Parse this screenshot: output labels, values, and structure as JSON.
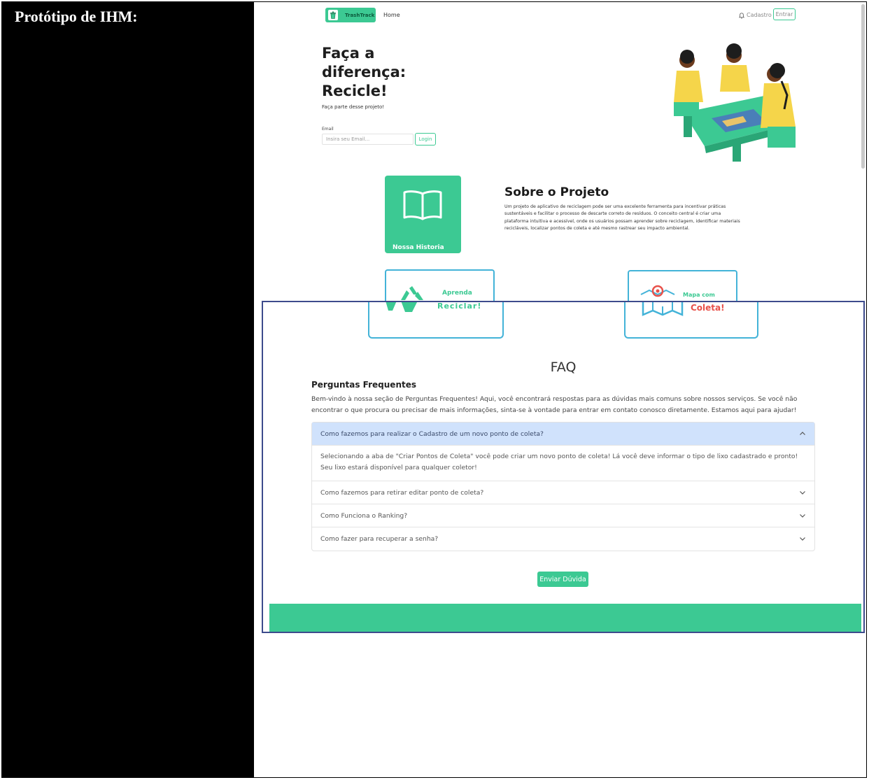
{
  "doc": {
    "label": "Protótipo de IHM:"
  },
  "navbar": {
    "logo_text": "TrashTrack",
    "home": "Home",
    "cadastro": "Cadastro",
    "entrar": "Entrar"
  },
  "hero": {
    "title": "Faça a diferença: Recicle!",
    "subtitle": "Faça parte desse projeto!",
    "email_label": "Email",
    "email_placeholder": "Insira seu Email...",
    "login": "Login"
  },
  "about": {
    "card_label": "Nossa Historia",
    "title": "Sobre o Projeto",
    "text": "Um projeto de aplicativo de reciclagem pode ser uma excelente ferramenta para incentivar práticas sustentáveis e facilitar o processo de descarte correto de resíduos. O conceito central é criar uma plataforma intuitiva e acessível, onde os usuários possam aprender sobre reciclagem, identificar materiais recicláveis, localizar pontos de coleta e até mesmo rastrear seu impacto ambiental."
  },
  "cards": {
    "aprenda_top": "Aprenda",
    "reciclar": "Reciclar!",
    "mapa_top": "Mapa com",
    "coleta": "Coleta!"
  },
  "faq": {
    "title": "FAQ",
    "subtitle": "Perguntas Frequentes",
    "intro": "Bem-vindo à nossa seção de Perguntas Frequentes! Aqui, você encontrará respostas para as dúvidas mais comuns sobre nossos serviços. Se você não encontrar o que procura ou precisar de mais informações, sinta-se à vontade para entrar em contato conosco diretamente. Estamos aqui para ajudar!",
    "items": [
      {
        "question": "Como fazemos para realizar o Cadastro de um novo ponto de coleta?",
        "answer": "Selecionando a aba de \"Criar Pontos de Coleta\" você pode criar um novo ponto de coleta! Lá você deve informar o tipo de lixo cadastrado e pronto! Seu lixo estará disponível para qualquer coletor!"
      },
      {
        "question": "Como fazemos para retirar editar ponto de coleta?"
      },
      {
        "question": "Como Funciona o Ranking?"
      },
      {
        "question": "Como fazer para recuperar a senha?"
      }
    ],
    "send_button": "Enviar Dúvida"
  },
  "colors": {
    "brand_green": "#3cc993",
    "accent_blue": "#43b3d8",
    "faq_open_bg": "#d0e2fc",
    "coleta_red": "#e8514a"
  }
}
